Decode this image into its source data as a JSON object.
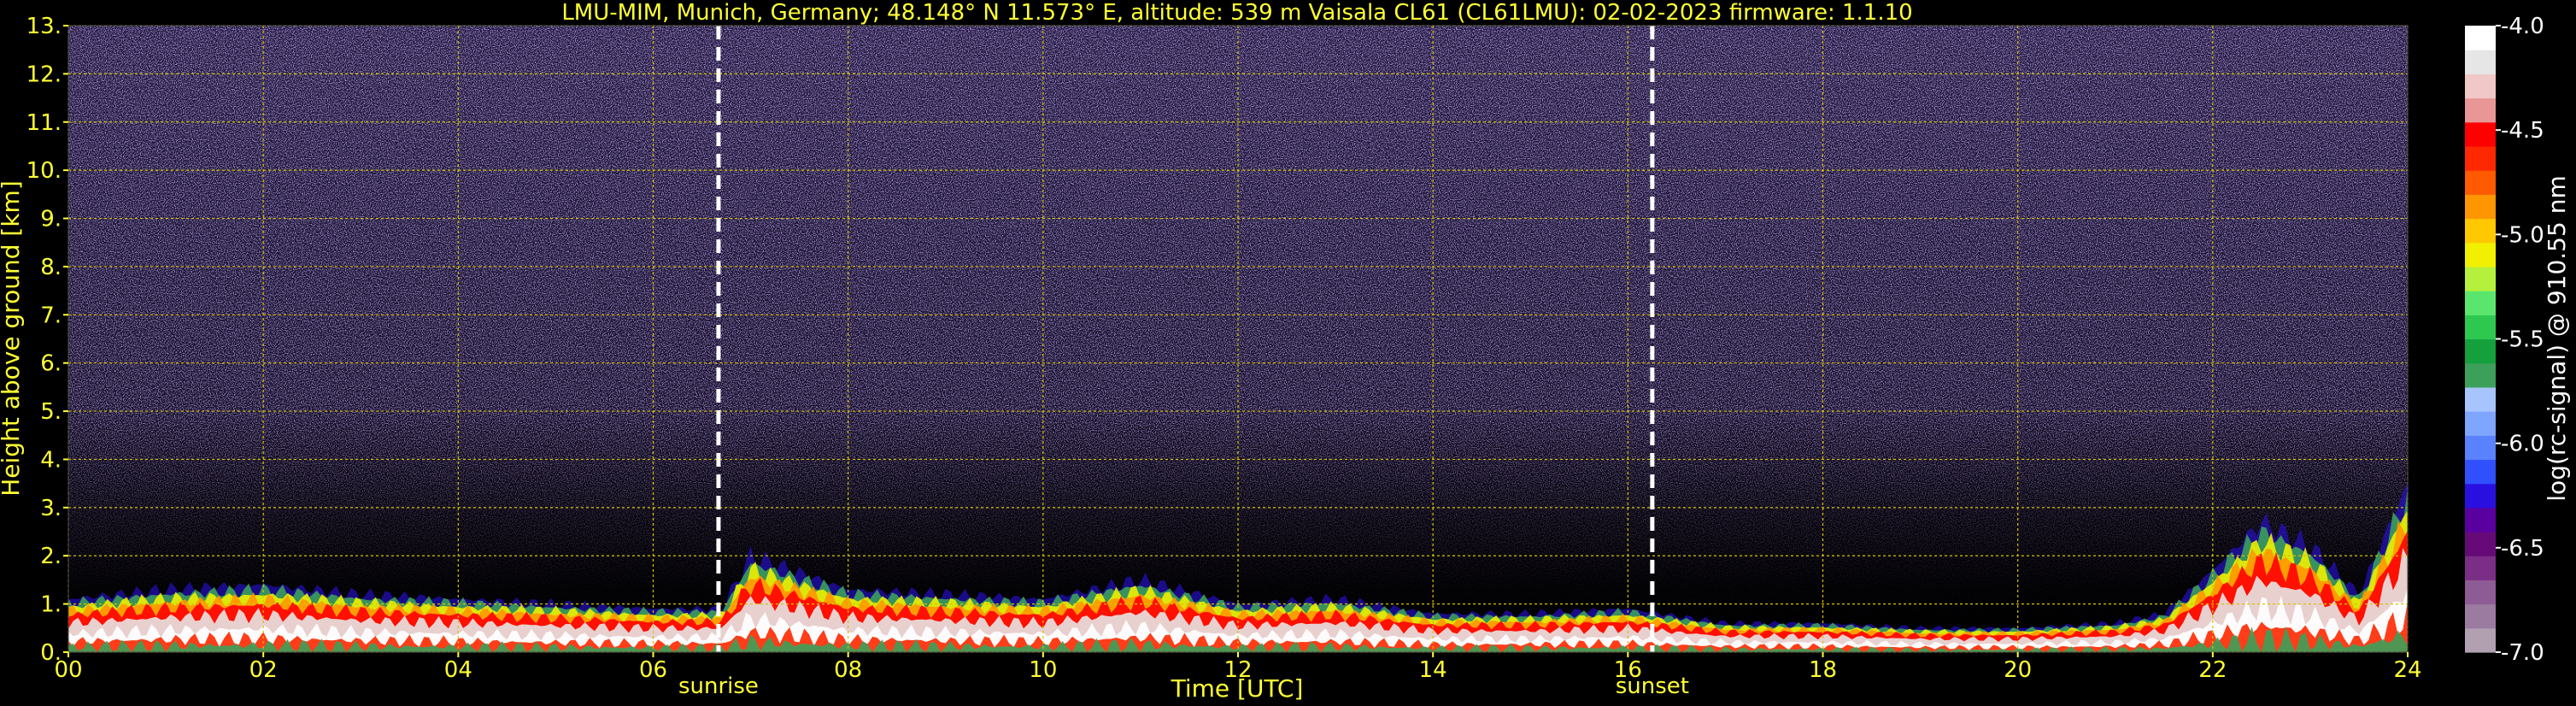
{
  "chart_data": {
    "type": "heatmap",
    "title": "LMU-MIM, Munich, Germany; 48.148° N 11.573° E, altitude: 539 m    Vaisala CL61 (CL61LMU): 02-02-2023    firmware: 1.1.10",
    "xlabel": "Time [UTC]",
    "ylabel": "Height above ground [km]",
    "xlim": [
      0,
      24
    ],
    "ylim": [
      0,
      13
    ],
    "x_ticks": [
      "00",
      "02",
      "04",
      "06",
      "08",
      "10",
      "12",
      "14",
      "16",
      "18",
      "20",
      "22",
      "24"
    ],
    "y_ticks": [
      "0.",
      "1.",
      "2.",
      "3.",
      "4.",
      "5.",
      "6.",
      "7.",
      "8.",
      "9.",
      "10.",
      "11.",
      "12.",
      "13."
    ],
    "grid": true,
    "annotations": [
      {
        "label": "sunrise",
        "x": 6.67
      },
      {
        "label": "sunset",
        "x": 16.25
      }
    ],
    "colorbar": {
      "label": "log(rc-signal) @ 910.55 nm",
      "range": [
        -7.0,
        -4.0
      ],
      "ticks": [
        "-4.0",
        "-4.5",
        "-5.0",
        "-5.5",
        "-6.0",
        "-6.5",
        "-7.0"
      ],
      "tick_values": [
        -4.0,
        -4.5,
        -5.0,
        -5.5,
        -6.0,
        -6.5,
        -7.0
      ],
      "colors": [
        "#b0a0b0",
        "#9c7ba0",
        "#8e5c94",
        "#7a2e86",
        "#660a78",
        "#5a00a0",
        "#2a10e0",
        "#3050ff",
        "#5a82ff",
        "#7fa5ff",
        "#a8c4ff",
        "#3ca05a",
        "#14a03c",
        "#2ec850",
        "#5ae66e",
        "#b4f03c",
        "#f0f000",
        "#ffc800",
        "#ff9600",
        "#ff5a00",
        "#ff2800",
        "#ff0000",
        "#e89696",
        "#f0c8c8",
        "#e6e6e6",
        "#ffffff"
      ]
    },
    "boundary_layer_top_km": [
      {
        "x": 0,
        "y": 1.1
      },
      {
        "x": 1,
        "y": 1.3
      },
      {
        "x": 2,
        "y": 1.4
      },
      {
        "x": 3,
        "y": 1.2
      },
      {
        "x": 4,
        "y": 1.1
      },
      {
        "x": 5,
        "y": 1.0
      },
      {
        "x": 6,
        "y": 0.9
      },
      {
        "x": 6.7,
        "y": 0.9
      },
      {
        "x": 7,
        "y": 2.0
      },
      {
        "x": 8,
        "y": 1.3
      },
      {
        "x": 9,
        "y": 1.2
      },
      {
        "x": 10,
        "y": 1.1
      },
      {
        "x": 11,
        "y": 1.5
      },
      {
        "x": 12,
        "y": 1.0
      },
      {
        "x": 13,
        "y": 1.1
      },
      {
        "x": 14,
        "y": 0.8
      },
      {
        "x": 15,
        "y": 0.8
      },
      {
        "x": 16,
        "y": 0.9
      },
      {
        "x": 17,
        "y": 0.6
      },
      {
        "x": 18,
        "y": 0.6
      },
      {
        "x": 19,
        "y": 0.5
      },
      {
        "x": 20,
        "y": 0.5
      },
      {
        "x": 21,
        "y": 0.6
      },
      {
        "x": 21.5,
        "y": 0.8
      },
      {
        "x": 22,
        "y": 1.7
      },
      {
        "x": 22.5,
        "y": 2.7
      },
      {
        "x": 23,
        "y": 2.2
      },
      {
        "x": 23.5,
        "y": 1.2
      },
      {
        "x": 24,
        "y": 3.5
      }
    ]
  }
}
